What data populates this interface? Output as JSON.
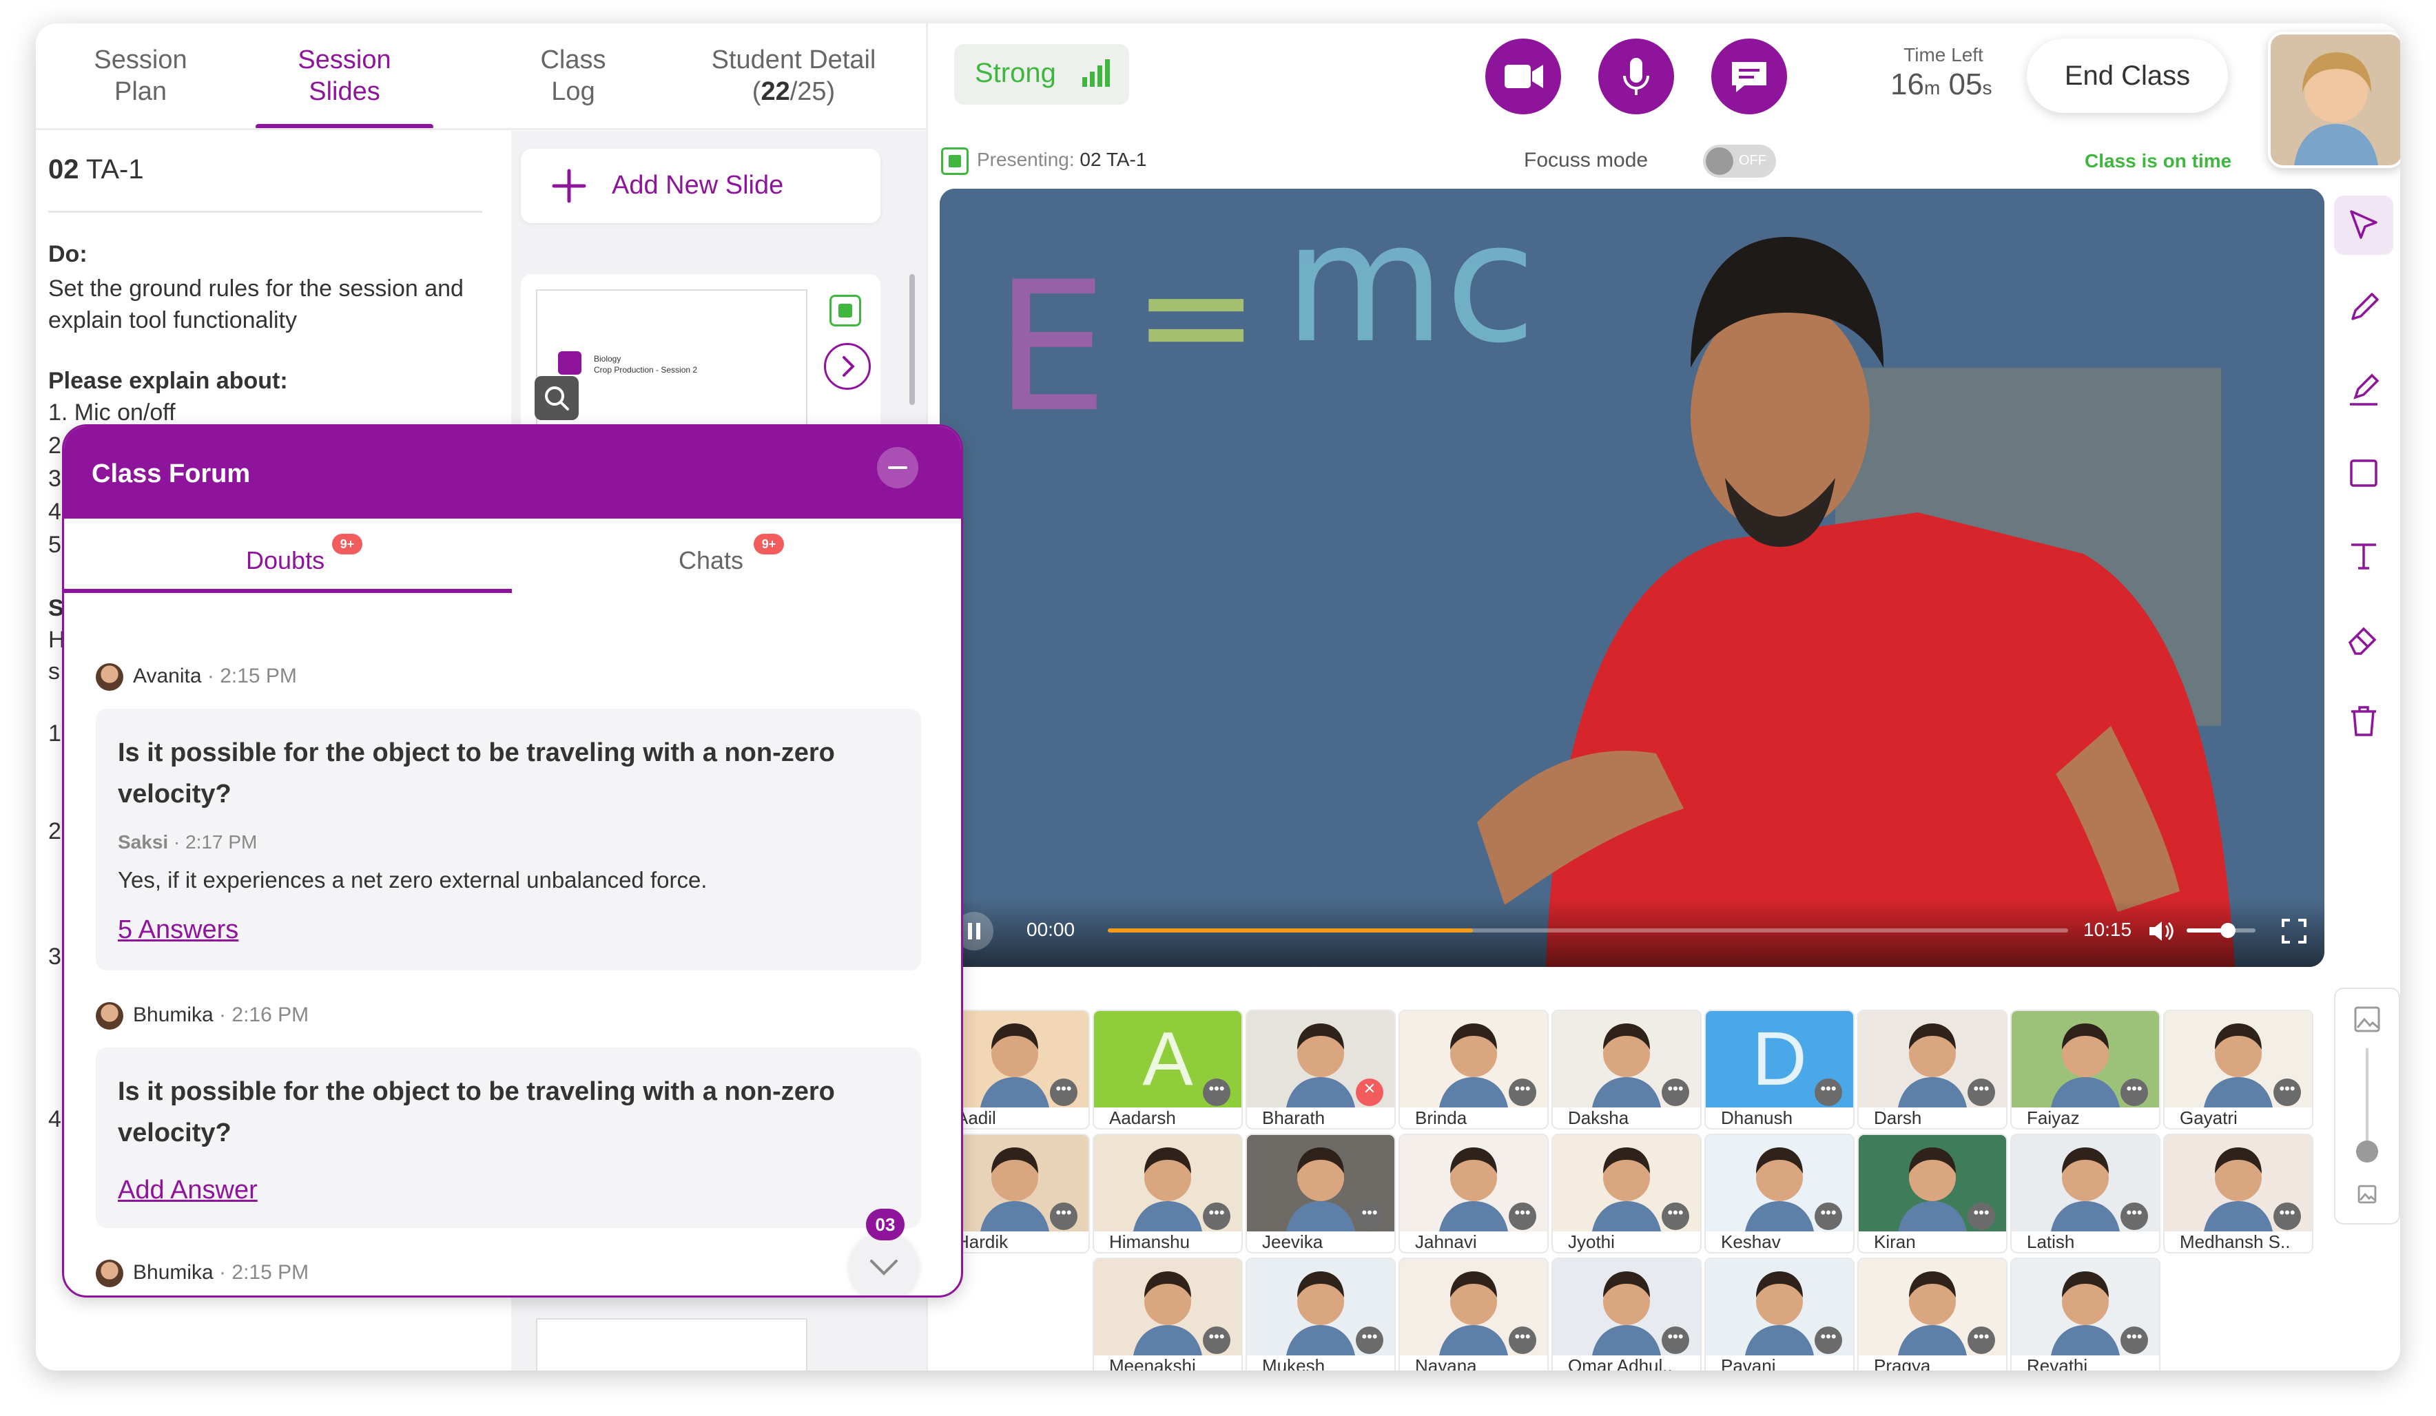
{
  "tabs": [
    {
      "line1": "Session",
      "line2": "Plan"
    },
    {
      "line1": "Session",
      "line2": "Slides"
    },
    {
      "line1": "Class",
      "line2": "Log"
    },
    {
      "line1": "Student Detail",
      "count_open": "(",
      "count": "22",
      "count_rest": "/25)"
    }
  ],
  "plan": {
    "num": "02",
    "title": "TA-1",
    "do_label": "Do:",
    "do_text": "Set the ground rules for the session and explain tool functionality",
    "explain_label": "Please explain about:",
    "item1": "1. Mic on/off",
    "peek": [
      "2",
      "3",
      "4",
      "5",
      "S",
      "H",
      "s",
      "1.",
      "2",
      "3",
      "4"
    ]
  },
  "slides": {
    "add_label": "Add New Slide",
    "thumb1_line1": "Biology",
    "thumb1_line2": "Crop Production - Session 2"
  },
  "header": {
    "network": "Strong",
    "time_left_label": "Time Left",
    "time_min": "16",
    "time_min_unit": "m",
    "time_sec": "05",
    "time_sec_unit": "s",
    "end_class": "End Class"
  },
  "status": {
    "presenting_label": "Presenting:",
    "presenting_value": "02 TA-1",
    "focus_label": "Focuss mode",
    "focus_toggle": "OFF",
    "on_time": "Class is on time"
  },
  "video": {
    "current": "00:00",
    "duration": "10:15",
    "progress": 0.38,
    "volume": 0.6
  },
  "students": [
    "Aadil",
    "Aadarsh",
    "Bharath",
    "Brinda",
    "Daksha",
    "Dhanush",
    "Darsh",
    "Faiyaz",
    "Gayatri",
    "Hardik",
    "Himanshu",
    "Jeevika",
    "Jahnavi",
    "Jyothi",
    "Keshav",
    "Kiran",
    "Latish",
    "Medhansh S..",
    "Meenakshi",
    "Mukesh",
    "Nayana",
    "Omar Adhul..",
    "Pavani",
    "Pragya",
    "Revathi"
  ],
  "forum": {
    "title": "Class Forum",
    "tab_doubts": "Doubts",
    "tab_chats": "Chats",
    "badge": "9+",
    "posts": [
      {
        "author": "Avanita",
        "time": "2:15 PM",
        "question": "Is it possible for the object to be traveling with a non-zero velocity?",
        "reply_author": "Saksi",
        "reply_time": "2:17 PM",
        "reply": "Yes, if it experiences a net zero external unbalanced force.",
        "link": "5 Answers"
      },
      {
        "author": "Bhumika",
        "time": "2:16 PM",
        "question": "Is it possible for the object to be traveling with a non-zero velocity?",
        "link": "Add Answer"
      },
      {
        "author": "Bhumika",
        "time": "2:15 PM"
      }
    ],
    "unread": "03"
  },
  "colors": {
    "accent": "#8e159b",
    "green": "#3fb73f",
    "badge": "#f25c5c",
    "progress": "#f59b1c"
  }
}
